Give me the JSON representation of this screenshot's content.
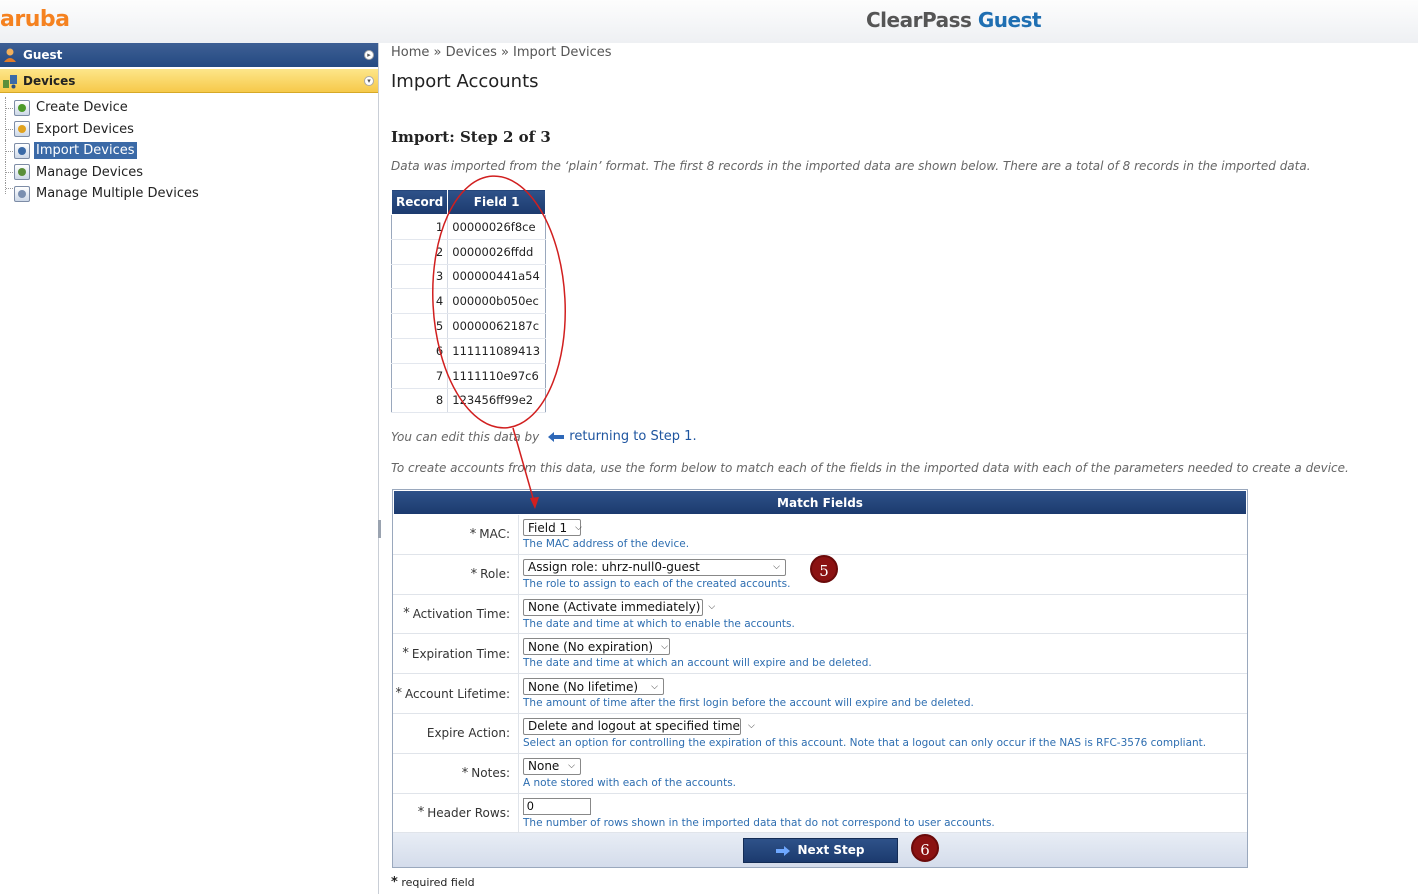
{
  "header": {
    "logo": "aruba",
    "title_part1": "ClearPass",
    "title_part2": "Guest",
    "brand_color": "#f58220",
    "accent_color": "#1f6fb2"
  },
  "sidebar": {
    "sections": [
      {
        "label": "Guest",
        "icon": "guest-icon"
      },
      {
        "label": "Devices",
        "icon": "devices-icon"
      }
    ],
    "items": [
      {
        "label": "Create Device",
        "icon": "create-device-icon"
      },
      {
        "label": "Export Devices",
        "icon": "export-devices-icon"
      },
      {
        "label": "Import Devices",
        "icon": "import-devices-icon",
        "active": true
      },
      {
        "label": "Manage Devices",
        "icon": "manage-devices-icon"
      },
      {
        "label": "Manage Multiple Devices",
        "icon": "manage-multiple-devices-icon"
      }
    ]
  },
  "main": {
    "breadcrumb": "Home » Devices » Import Devices",
    "page_title": "Import Accounts",
    "step_title": "Import: Step 2 of 3",
    "intro": "Data was imported from the ‘plain’ format. The first 8 records in the imported data are shown below. There are a total of 8 records in the imported data.",
    "record_table": {
      "headers": [
        "Record",
        "Field 1"
      ],
      "rows": [
        [
          "1",
          "00000026f8ce"
        ],
        [
          "2",
          "00000026ffdd"
        ],
        [
          "3",
          "000000441a54"
        ],
        [
          "4",
          "000000b050ec"
        ],
        [
          "5",
          "00000062187c"
        ],
        [
          "6",
          "111111089413"
        ],
        [
          "7",
          "1111110e97c6"
        ],
        [
          "8",
          "123456ff99e2"
        ]
      ]
    },
    "edit_note_prefix": "You can edit this data by",
    "edit_note_link": "returning to Step 1.",
    "create_note": "To create accounts from this data, use the form below to match each of the fields in the imported data with each of the parameters needed to create a device.",
    "match_form": {
      "title": "Match Fields",
      "fields": [
        {
          "label": "MAC:",
          "required": true,
          "type": "select",
          "value": "Field 1",
          "width": 58,
          "help": "The MAC address of the device."
        },
        {
          "label": "Role:",
          "required": true,
          "type": "select",
          "value": "Assign role: uhrz-null0-guest",
          "width": 263,
          "help": "The role to assign to each of the created accounts."
        },
        {
          "label": "Activation Time:",
          "required": true,
          "type": "select",
          "value": "None (Activate immediately)",
          "width": 180,
          "help": "The date and time at which to enable the accounts."
        },
        {
          "label": "Expiration Time:",
          "required": true,
          "type": "select",
          "value": "None (No expiration)",
          "width": 147,
          "help": "The date and time at which an account will expire and be deleted."
        },
        {
          "label": "Account Lifetime:",
          "required": true,
          "type": "select",
          "value": "None (No lifetime)",
          "width": 141,
          "help": "The amount of time after the first login before the account will expire and be deleted."
        },
        {
          "label": "Expire Action:",
          "required": false,
          "type": "select",
          "value": "Delete and logout at specified time",
          "width": 218,
          "help": "Select an option for controlling the expiration of this account. Note that a logout can only occur if the NAS is RFC-3576 compliant."
        },
        {
          "label": "Notes:",
          "required": true,
          "type": "select",
          "value": "None",
          "width": 58,
          "help": "A note stored with each of the accounts."
        },
        {
          "label": "Header Rows:",
          "required": true,
          "type": "input",
          "value": "0",
          "width": 68,
          "help": "The number of rows shown in the imported data that do not correspond to user accounts."
        }
      ],
      "next_button": "Next Step"
    },
    "required_note": "required field",
    "required_mark": "*"
  },
  "annotations": {
    "badge5": "5",
    "badge6": "6",
    "color": "#d11f1f"
  }
}
